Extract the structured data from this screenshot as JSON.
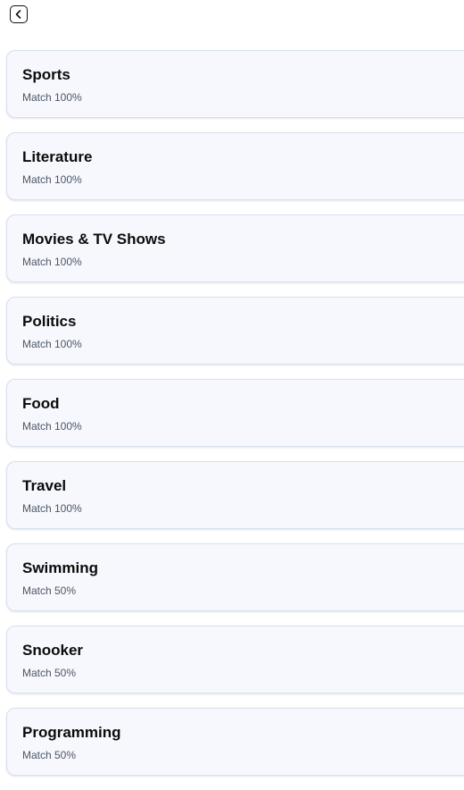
{
  "header": {
    "back_icon": "chevron-left-icon"
  },
  "interests": [
    {
      "name": "Sports",
      "match": "Match 100%"
    },
    {
      "name": "Literature",
      "match": "Match 100%"
    },
    {
      "name": "Movies & TV Shows",
      "match": "Match 100%"
    },
    {
      "name": "Politics",
      "match": "Match 100%"
    },
    {
      "name": "Food",
      "match": "Match 100%"
    },
    {
      "name": "Travel",
      "match": "Match 100%"
    },
    {
      "name": "Swimming",
      "match": "Match 50%"
    },
    {
      "name": "Snooker",
      "match": "Match 50%"
    },
    {
      "name": "Programming",
      "match": "Match 50%"
    }
  ],
  "colors": {
    "card_background": "#f6f8fd",
    "card_border": "#d6e0ef",
    "title_text": "#0b0b0b",
    "secondary_text": "#4d5566"
  }
}
